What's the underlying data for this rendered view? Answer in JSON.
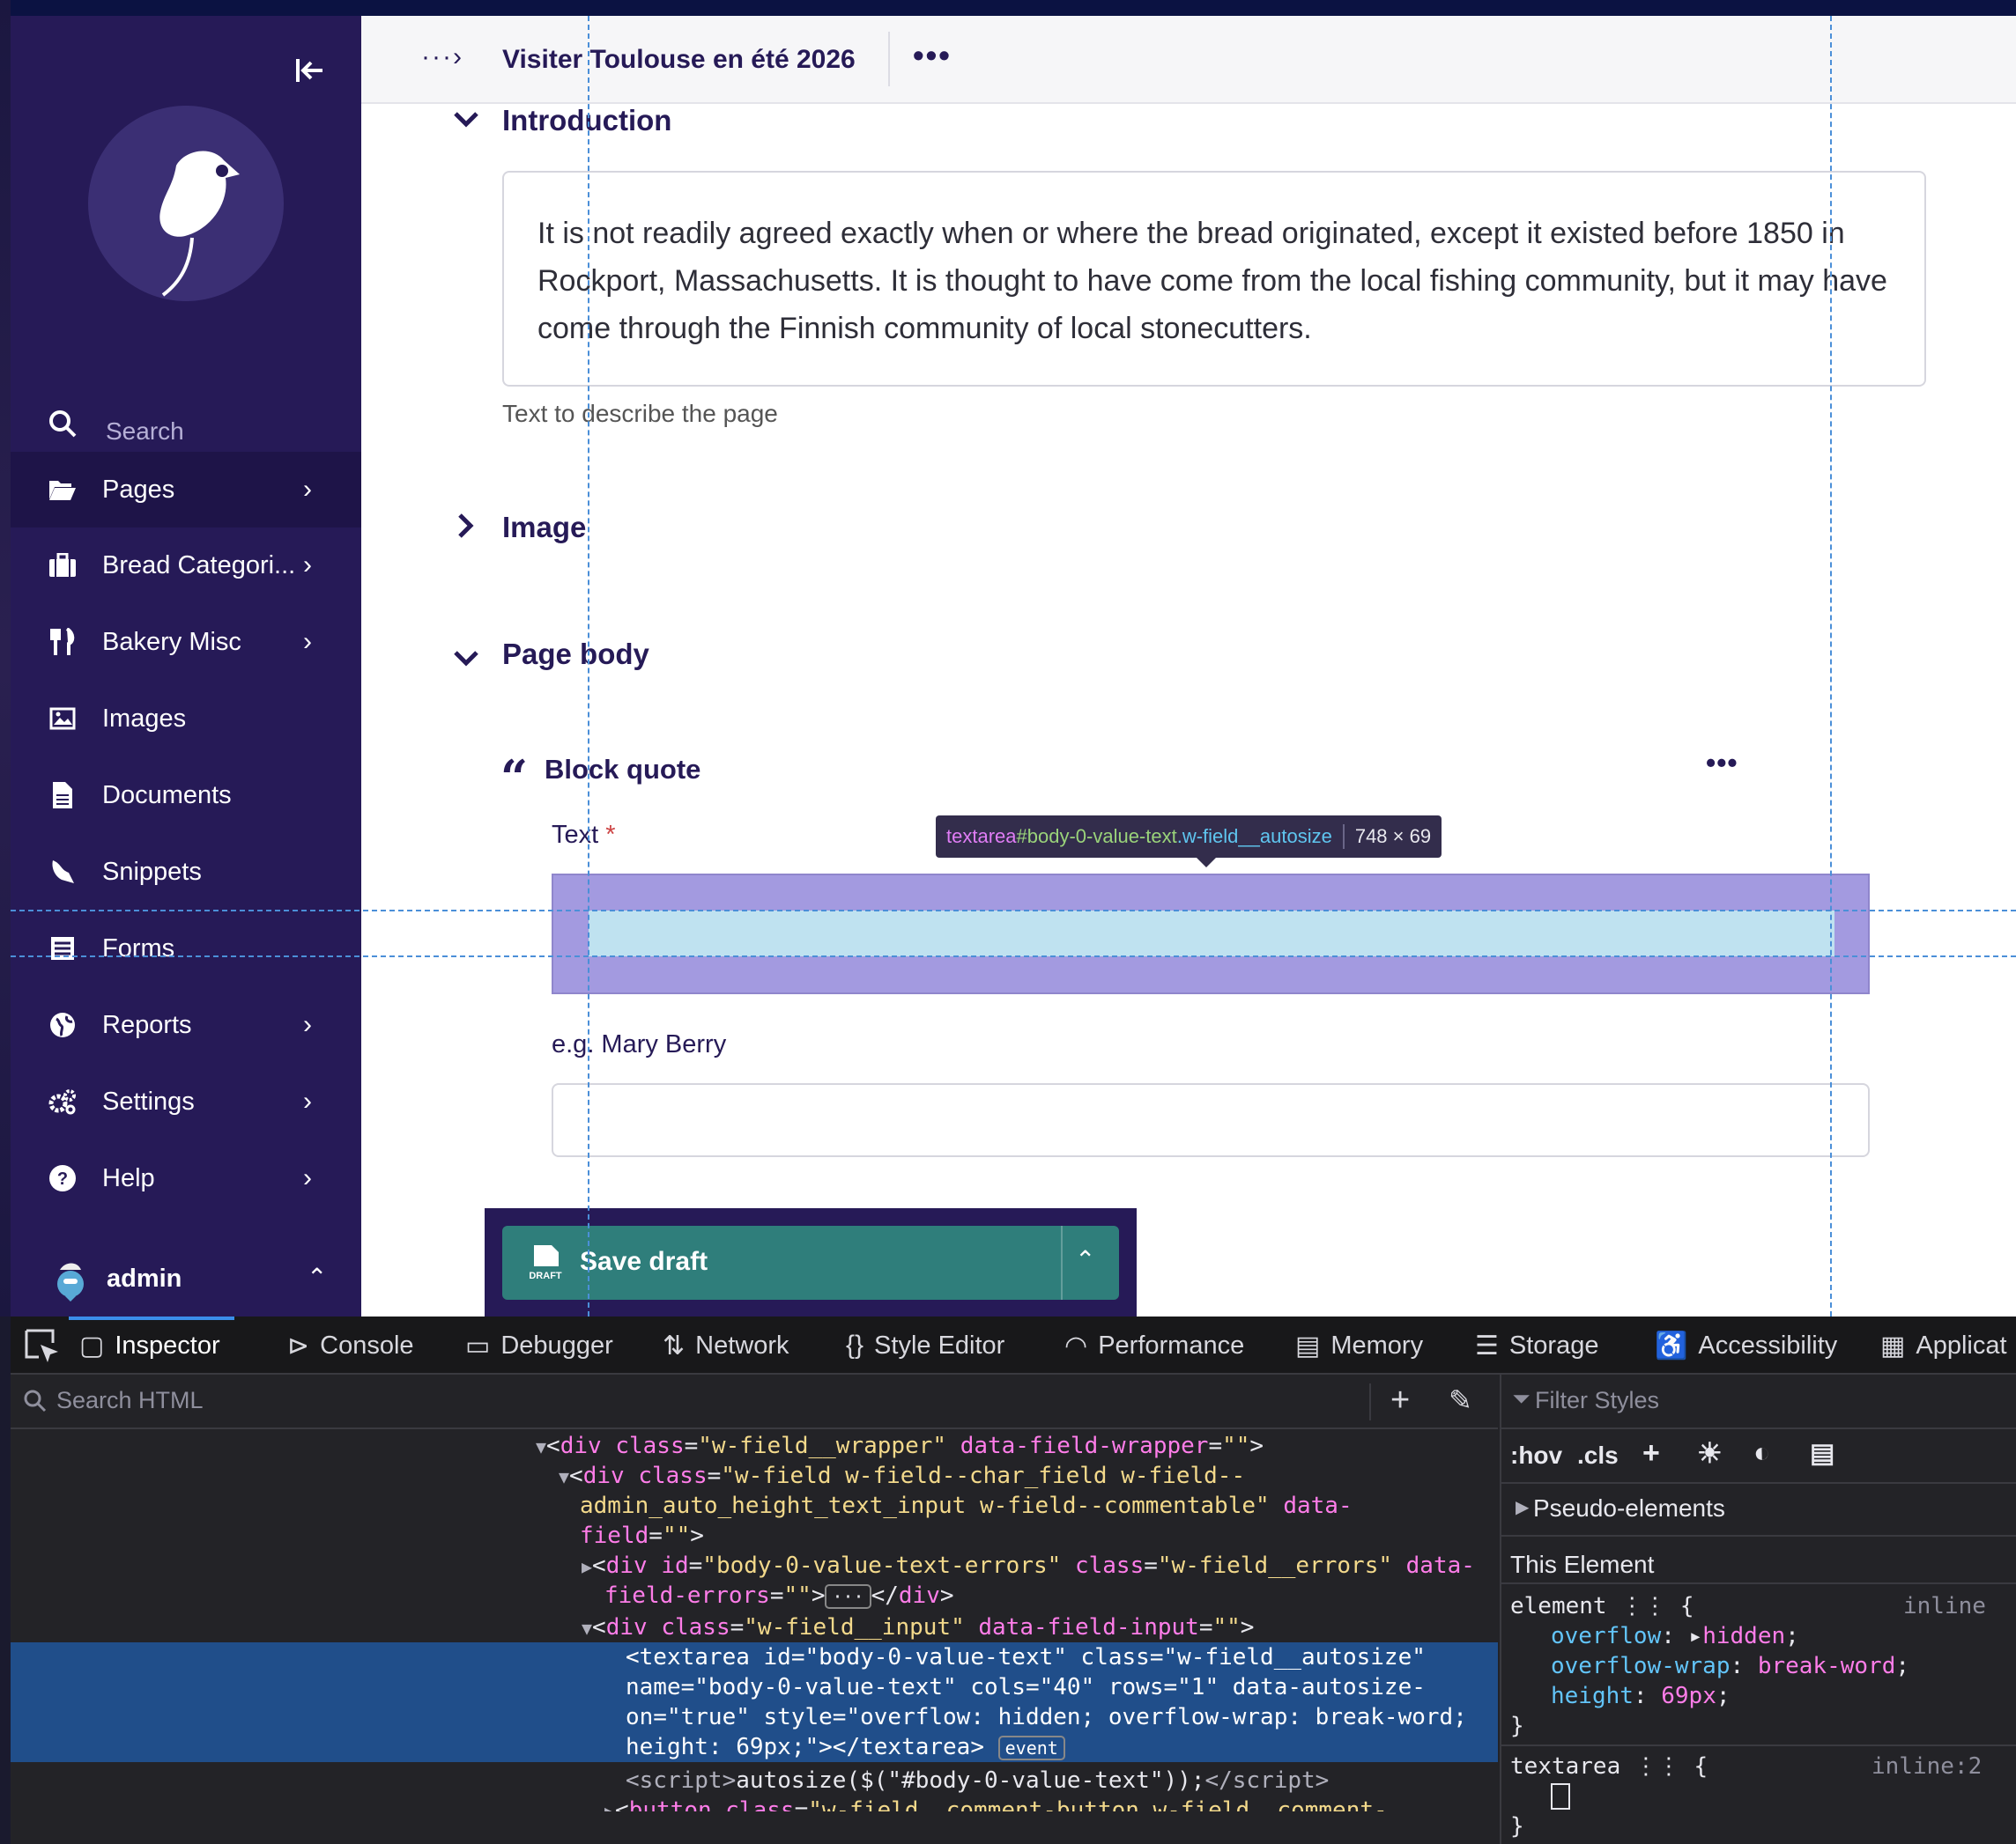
{
  "sidebar": {
    "search_placeholder": "Search",
    "items": [
      {
        "label": "Pages",
        "icon": "folder-open-icon",
        "chevron": "›"
      },
      {
        "label": "Bread Categori...",
        "icon": "suitcase-icon",
        "chevron": "›"
      },
      {
        "label": "Bakery Misc",
        "icon": "utensils-icon",
        "chevron": "›"
      },
      {
        "label": "Images",
        "icon": "image-icon",
        "chevron": ""
      },
      {
        "label": "Documents",
        "icon": "document-icon",
        "chevron": ""
      },
      {
        "label": "Snippets",
        "icon": "snippet-icon",
        "chevron": ""
      },
      {
        "label": "Forms",
        "icon": "form-icon",
        "chevron": ""
      },
      {
        "label": "Reports",
        "icon": "globe-icon",
        "chevron": "›"
      },
      {
        "label": "Settings",
        "icon": "cogs-icon",
        "chevron": "›"
      },
      {
        "label": "Help",
        "icon": "help-icon",
        "chevron": "›"
      }
    ],
    "user": {
      "label": "admin"
    }
  },
  "header": {
    "title": "Visiter Toulouse en été 2026"
  },
  "main": {
    "intro": {
      "title": "Introduction",
      "text": "It is not readily agreed exactly when or where the bread originated, except it existed before 1850 in Rockport, Massachusetts. It is thought to have come from the local fishing community, but it may have come through the Finnish community of local stonecutters.",
      "help": "Text to describe the page"
    },
    "image": {
      "title": "Image"
    },
    "body": {
      "title": "Page body",
      "block": {
        "label": "Block quote",
        "text_label": "Text",
        "required": "*",
        "attribution_label": "e.g. Mary Berry"
      }
    },
    "tooltip": {
      "tag": "textarea",
      "id": "#body-0-value-text",
      "cls": ".w-field__autosize",
      "size": "748 × 69"
    },
    "save": {
      "label": "Save draft",
      "icon_text": "DRAFT"
    }
  },
  "devtools": {
    "tabs": [
      {
        "label": "Inspector",
        "icon": "inspector-icon"
      },
      {
        "label": "Console",
        "icon": "console-icon"
      },
      {
        "label": "Debugger",
        "icon": "debugger-icon"
      },
      {
        "label": "Network",
        "icon": "network-icon"
      },
      {
        "label": "Style Editor",
        "icon": "style-editor-icon"
      },
      {
        "label": "Performance",
        "icon": "performance-icon"
      },
      {
        "label": "Memory",
        "icon": "memory-icon"
      },
      {
        "label": "Storage",
        "icon": "storage-icon"
      },
      {
        "label": "Accessibility",
        "icon": "accessibility-icon"
      },
      {
        "label": "Applicat",
        "icon": "application-icon"
      }
    ],
    "search_html_placeholder": "Search HTML",
    "filter_styles_placeholder": "Filter Styles",
    "hov": ":hov",
    "cls": ".cls",
    "pseudo": "Pseudo-elements",
    "this_element": "This Element",
    "rule1": {
      "selector": "element",
      "source": "inline",
      "props": [
        {
          "p": "overflow",
          "v": "hidden"
        },
        {
          "p": "overflow-wrap",
          "v": "break-word"
        },
        {
          "p": "height",
          "v": "69px"
        }
      ]
    },
    "rule2": {
      "selector": "textarea",
      "source": "inline:2"
    },
    "event_badge": "event"
  },
  "colors": {
    "sidebar": "#261a57",
    "accent": "#2f7e7b",
    "highlight": "#a39ae0"
  }
}
